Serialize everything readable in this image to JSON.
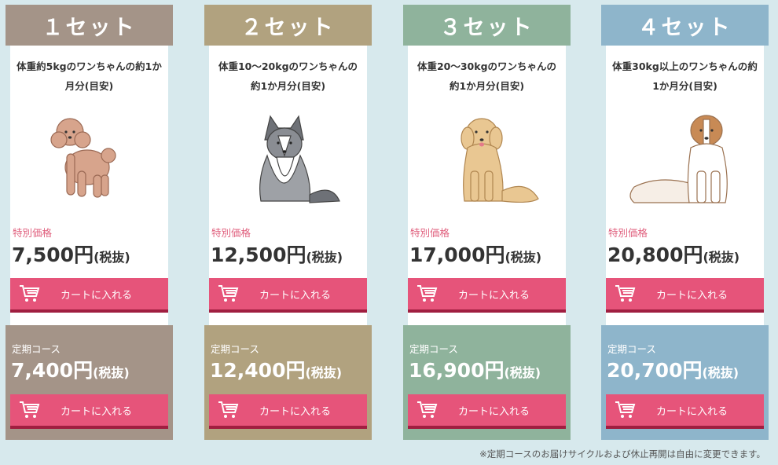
{
  "colors": {
    "background": "#d7e9ed",
    "accent_pink": "#e6547a",
    "price_label_pink": "#e0607e",
    "button_shadow": "#a01e40"
  },
  "plans": [
    {
      "title": "１セット",
      "color": "#a49488",
      "description": "体重約5kgのワンちゃんの約1か月分(目安)",
      "dog_icon": "toy-poodle-illustration",
      "special_label": "特別価格",
      "special_price": "7,500円",
      "tax_note": "(税抜)",
      "cart_label": "カートに入れる",
      "regular_label": "定期コース",
      "regular_price": "7,400円",
      "regular_tax_note": "(税抜)",
      "regular_cart_label": "カートに入れる"
    },
    {
      "title": "２セット",
      "color": "#b1a27f",
      "description": "体重10〜20kgのワンちゃんの約1か月分(目安)",
      "dog_icon": "australian-shepherd-illustration",
      "special_label": "特別価格",
      "special_price": "12,500円",
      "tax_note": "(税抜)",
      "cart_label": "カートに入れる",
      "regular_label": "定期コース",
      "regular_price": "12,400円",
      "regular_tax_note": "(税抜)",
      "regular_cart_label": "カートに入れる"
    },
    {
      "title": "３セット",
      "color": "#8fb39c",
      "description": "体重20〜30kgのワンちゃんの約1か月分(目安)",
      "dog_icon": "golden-retriever-illustration",
      "special_label": "特別価格",
      "special_price": "17,000円",
      "tax_note": "(税抜)",
      "cart_label": "カートに入れる",
      "regular_label": "定期コース",
      "regular_price": "16,900円",
      "regular_tax_note": "(税抜)",
      "regular_cart_label": "カートに入れる"
    },
    {
      "title": "４セット",
      "color": "#8eb5cb",
      "description": "体重30kg以上のワンちゃんの約1か月分(目安)",
      "dog_icon": "saint-bernard-illustration",
      "special_label": "特別価格",
      "special_price": "20,800円",
      "tax_note": "(税抜)",
      "cart_label": "カートに入れる",
      "regular_label": "定期コース",
      "regular_price": "20,700円",
      "regular_tax_note": "(税抜)",
      "regular_cart_label": "カートに入れる"
    }
  ],
  "footer_note": "※定期コースのお届けサイクルおよび休止再開は自由に変更できます。"
}
